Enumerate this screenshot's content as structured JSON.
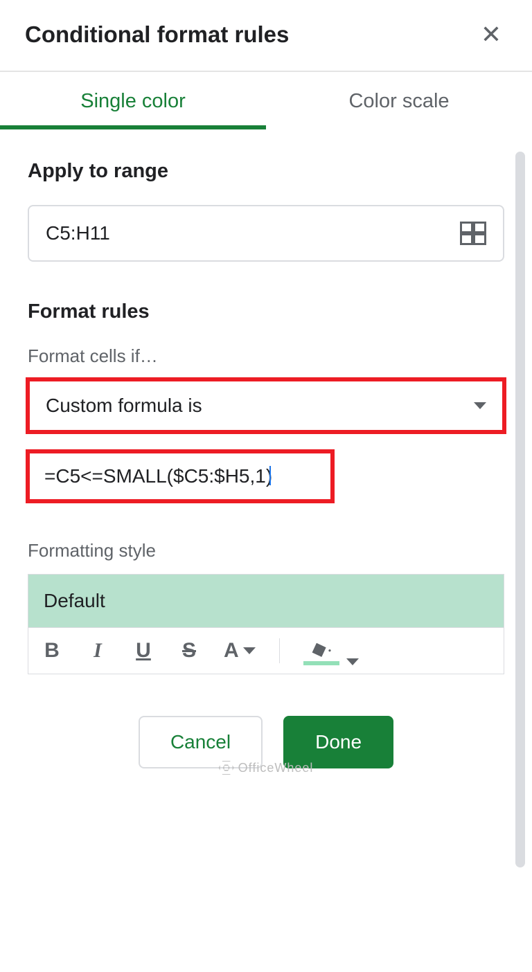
{
  "header": {
    "title": "Conditional format rules"
  },
  "tabs": {
    "single": "Single color",
    "scale": "Color scale"
  },
  "range": {
    "heading": "Apply to range",
    "value": "C5:H11"
  },
  "rules": {
    "heading": "Format rules",
    "condition_label": "Format cells if…",
    "condition_value": "Custom formula is",
    "formula_value": "=C5<=SMALL($C5:$H5,1)"
  },
  "style": {
    "label": "Formatting style",
    "preview_text": "Default"
  },
  "buttons": {
    "cancel": "Cancel",
    "done": "Done"
  },
  "watermark": "OfficeWheel"
}
